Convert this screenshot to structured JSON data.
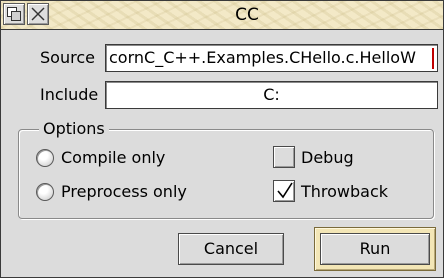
{
  "window": {
    "title": "CC",
    "back_icon": "window-back-icon",
    "close_icon": "window-close-icon"
  },
  "source": {
    "label": "Source",
    "value": "cornC_C++.Examples.CHello.c.HelloW"
  },
  "include": {
    "label": "Include",
    "value": "C:"
  },
  "options": {
    "title": "Options",
    "compile_only": {
      "label": "Compile only",
      "selected": false
    },
    "preprocess_only": {
      "label": "Preprocess only",
      "selected": false
    },
    "debug": {
      "label": "Debug",
      "checked": false
    },
    "throwback": {
      "label": "Throwback",
      "checked": true
    }
  },
  "buttons": {
    "cancel": "Cancel",
    "run": "Run"
  },
  "colors": {
    "title_bar": "#f3e9c7",
    "window_bg": "#dcdcdc",
    "default_button_border": "#f3e6b6",
    "caret": "#c00000"
  }
}
